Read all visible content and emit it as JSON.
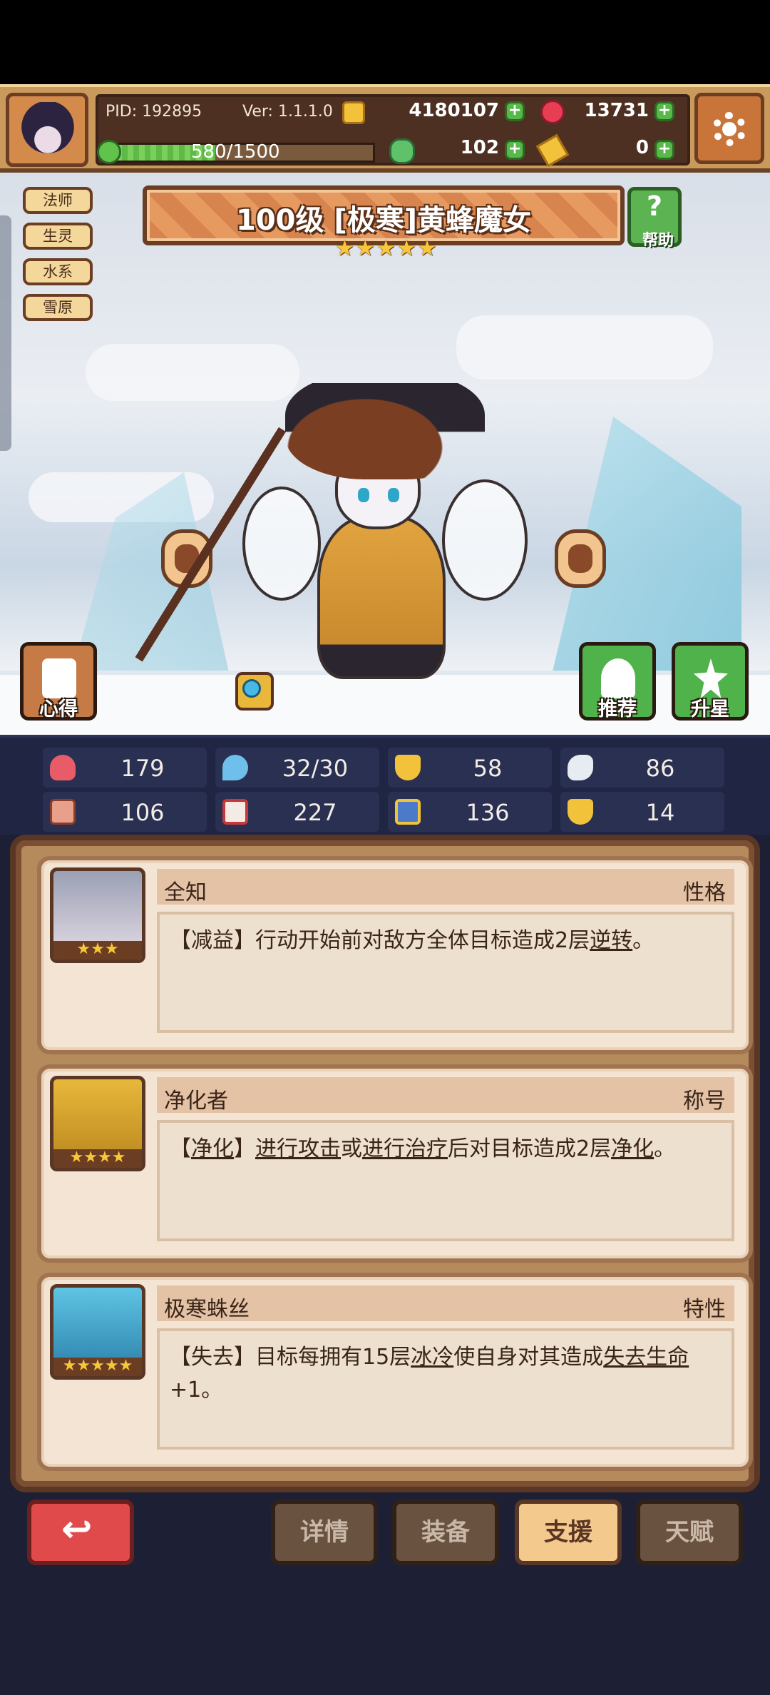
{
  "header": {
    "pid": "PID: 192895",
    "version": "Ver: 1.1.1.0",
    "gold": "4180107",
    "gems": "13731",
    "exp": "580/1500",
    "exp_fraction": 0.387,
    "clover": "102",
    "keys": "0"
  },
  "tags": [
    "法师",
    "生灵",
    "水系",
    "雪原"
  ],
  "hero": {
    "title": "100级  [极寒]黄蜂魔女",
    "stars": 5,
    "help_label": "帮助",
    "left_button_label": "心得",
    "recommend_label": "推荐",
    "upgrade_label": "升星"
  },
  "stats": {
    "hp": "179",
    "mana": "32/30",
    "defense": "58",
    "speed": "86",
    "attack": "106",
    "magic": "227",
    "resist": "136",
    "luck": "14"
  },
  "traits": [
    {
      "name": "全知",
      "type": "性格",
      "stars": "★★★",
      "desc_parts": [
        "【减益】行动开始前对敌方全体目标造成2层",
        "逆转",
        "。"
      ]
    },
    {
      "name": "净化者",
      "type": "称号",
      "stars": "★★★★",
      "desc_parts": [
        "【",
        "净化",
        "】",
        "进行攻击",
        "或",
        "进行治疗",
        "后对目标造成2层",
        "净化",
        "。"
      ]
    },
    {
      "name": "极寒蛛丝",
      "type": "特性",
      "stars": "★★★★★",
      "desc_parts": [
        "【失去】目标每拥有15层",
        "冰冷",
        "使自身对其造成",
        "失去生命",
        "+1。"
      ]
    }
  ],
  "nav": {
    "details": "详情",
    "equipment": "装备",
    "support": "支援",
    "talent": "天赋"
  }
}
